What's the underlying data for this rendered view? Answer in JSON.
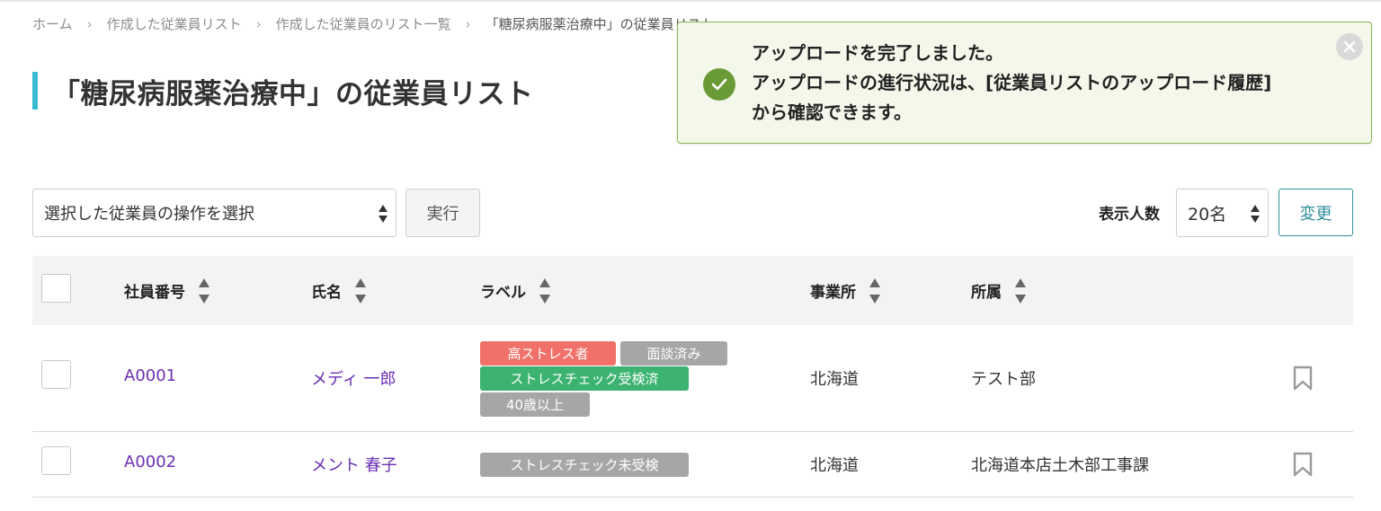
{
  "breadcrumb": [
    "ホーム",
    "作成した従業員リスト",
    "作成した従業員のリスト一覧",
    "「糖尿病服薬治療中」の従業員リスト"
  ],
  "page_title": "「糖尿病服薬治療中」の従業員リスト",
  "toast": {
    "line1": "アップロードを完了しました。",
    "line2": "アップロードの進行状況は、[従業員リストのアップロード履歴]",
    "line3": "から確認できます。",
    "icon": "check-circle-icon",
    "close_icon": "close-icon"
  },
  "controls": {
    "action_select": "選択した従業員の操作を選択",
    "run_button": "実行",
    "per_page_label": "表示人数",
    "per_page_value": "20名",
    "change_button": "変更"
  },
  "table": {
    "columns": [
      "社員番号",
      "氏名",
      "ラベル",
      "事業所",
      "所属"
    ],
    "rows": [
      {
        "id": "A0001",
        "name": "メディ 一郎",
        "labels": [
          "高ストレス者",
          "面談済み",
          "ストレスチェック受検済",
          "40歳以上"
        ],
        "office": "北海道",
        "dept": "テスト部"
      },
      {
        "id": "A0002",
        "name": "メント 春子",
        "labels": [
          "ストレスチェック未受検"
        ],
        "office": "北海道",
        "dept": "北海道本店土木部工事課"
      }
    ]
  },
  "colors": {
    "accent": "#38bcd4",
    "link": "#6b2fb3",
    "tag_red": "#f0716a",
    "tag_gray": "#a6a6a6",
    "tag_green": "#3cb371",
    "toast_bg": "#f3f8ea",
    "toast_border": "#8bb355",
    "success": "#6a9a36"
  }
}
